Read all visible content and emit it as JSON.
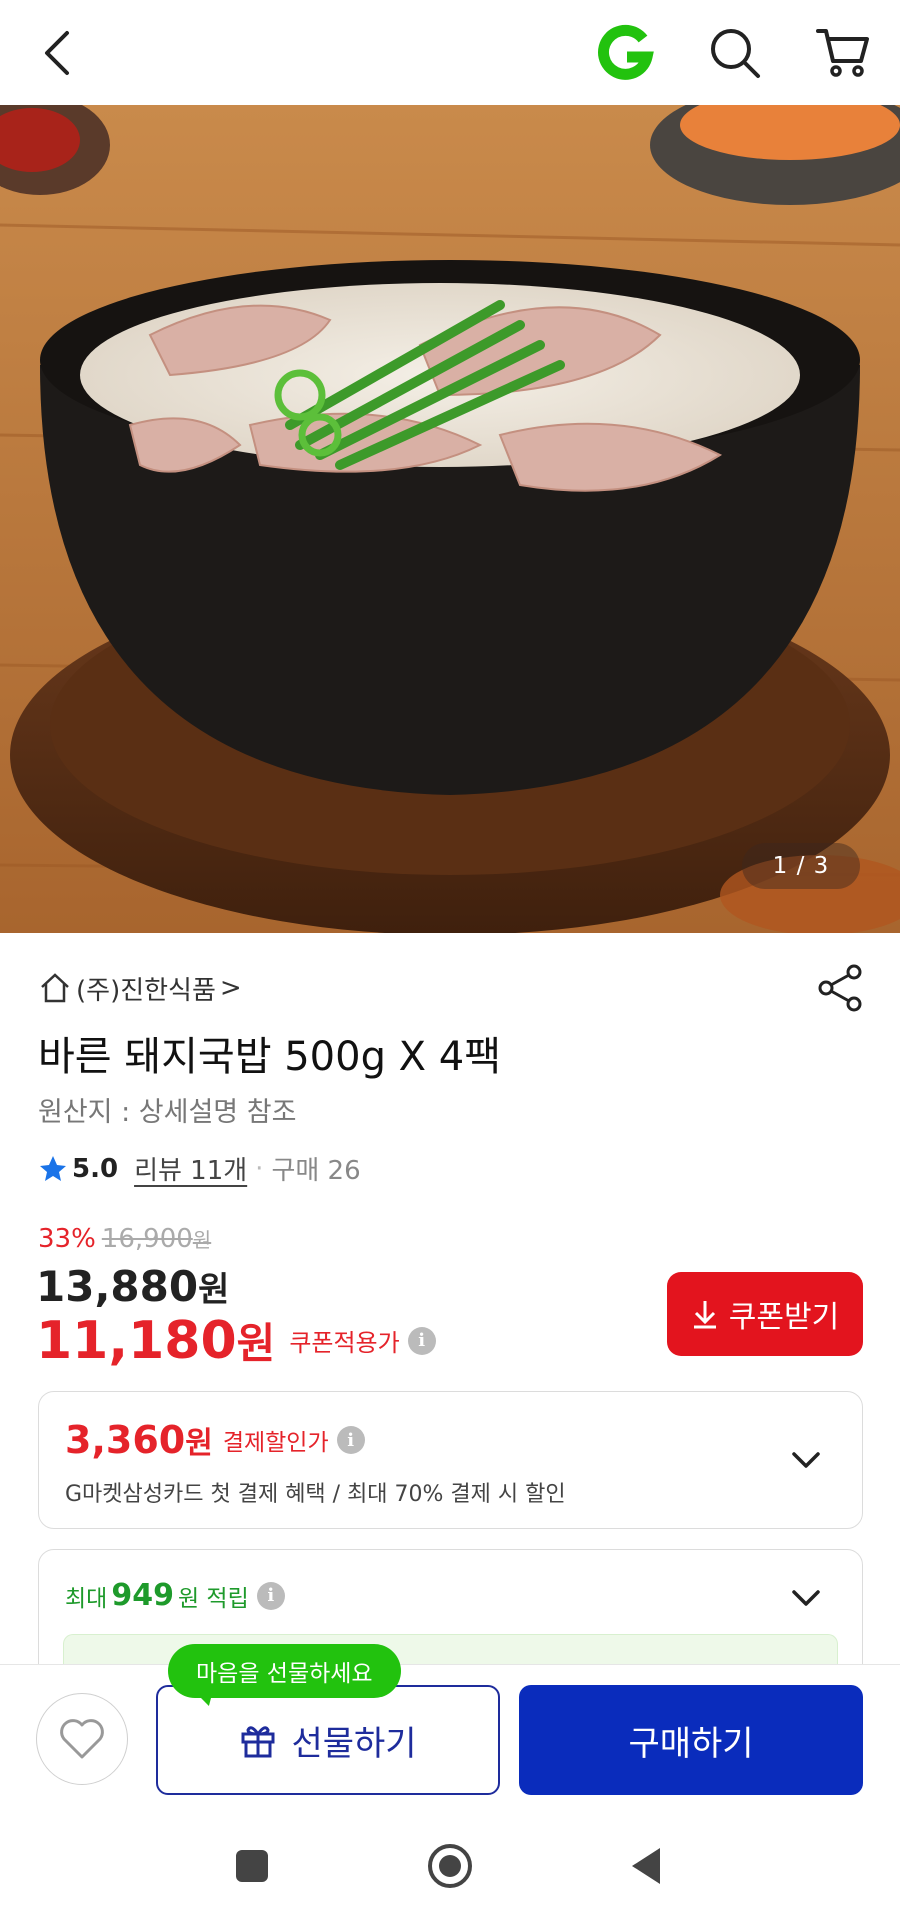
{
  "header": {
    "back_icon": "chevron-left-icon",
    "logo_text": "G",
    "logo_color": "#22c20e",
    "search_icon": "search-icon",
    "cart_icon": "cart-icon"
  },
  "hero": {
    "image": "gukbap-bowl-photo",
    "counter": "1 / 3"
  },
  "product": {
    "seller": "(주)진한식품",
    "seller_chevron": ">",
    "title": "바른 돼지국밥 500g X 4팩",
    "origin": "원산지 : 상세설명 참조",
    "rating": "5.0",
    "reviews": "리뷰 11개",
    "dot": "·",
    "purchases": "구매 26",
    "discount_rate": "33%",
    "original_price": "16,900",
    "original_price_unit": "원",
    "price": "13,880",
    "price_unit": "원",
    "coupon_price": "11,180",
    "coupon_price_unit": "원",
    "coupon_price_label": "쿠폰적용가",
    "coupon_button": "쿠폰받기"
  },
  "payment_card": {
    "amount": "3,360",
    "unit": "원",
    "label": "결제할인가",
    "description": "G마켓삼성카드 첫 결제 혜택 / 최대 70% 결제 시 할인"
  },
  "points_card": {
    "prefix": "최대",
    "amount": "949",
    "suffix": "원 적립"
  },
  "bottom_bar": {
    "tooltip": "마음을 선물하세요",
    "gift_button": "선물하기",
    "buy_button": "구매하기"
  },
  "colors": {
    "accent_red": "#e5232a",
    "primary_blue": "#0a2cbc",
    "green": "#22c20e",
    "star_blue": "#1a73e8"
  }
}
